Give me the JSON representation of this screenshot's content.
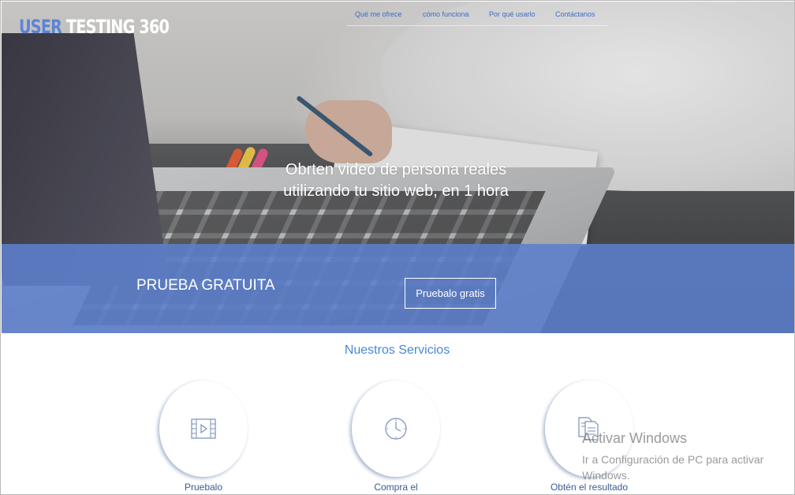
{
  "logo": {
    "part1": "USER",
    "part2": "TESTING 360"
  },
  "nav": {
    "items": [
      {
        "label": "Qué me ofrece"
      },
      {
        "label": "cómo funciona"
      },
      {
        "label": "Por qué usarlo"
      },
      {
        "label": "Contáctanos"
      }
    ]
  },
  "hero": {
    "line1": "Obrten video de persona reales",
    "line2": "utilizando tu sitio web, en 1 hora"
  },
  "band": {
    "title": "PRUEBA GRATUITA",
    "button_label": "Pruebalo gratis",
    "color": "#5c80cd"
  },
  "services": {
    "title": "Nuestros Servicios",
    "items": [
      {
        "label": "Pruebalo",
        "icon": "video-icon"
      },
      {
        "label": "Compra el",
        "icon": "clock-icon"
      },
      {
        "label": "Obtén el resultado",
        "icon": "documents-icon"
      }
    ]
  },
  "watermark": {
    "title": "Activar Windows",
    "line1": "Ir a Configuración de PC para activar",
    "line2": "Windows."
  },
  "colors": {
    "accent": "#4a86d6",
    "nav_link": "#3b6cc8"
  }
}
